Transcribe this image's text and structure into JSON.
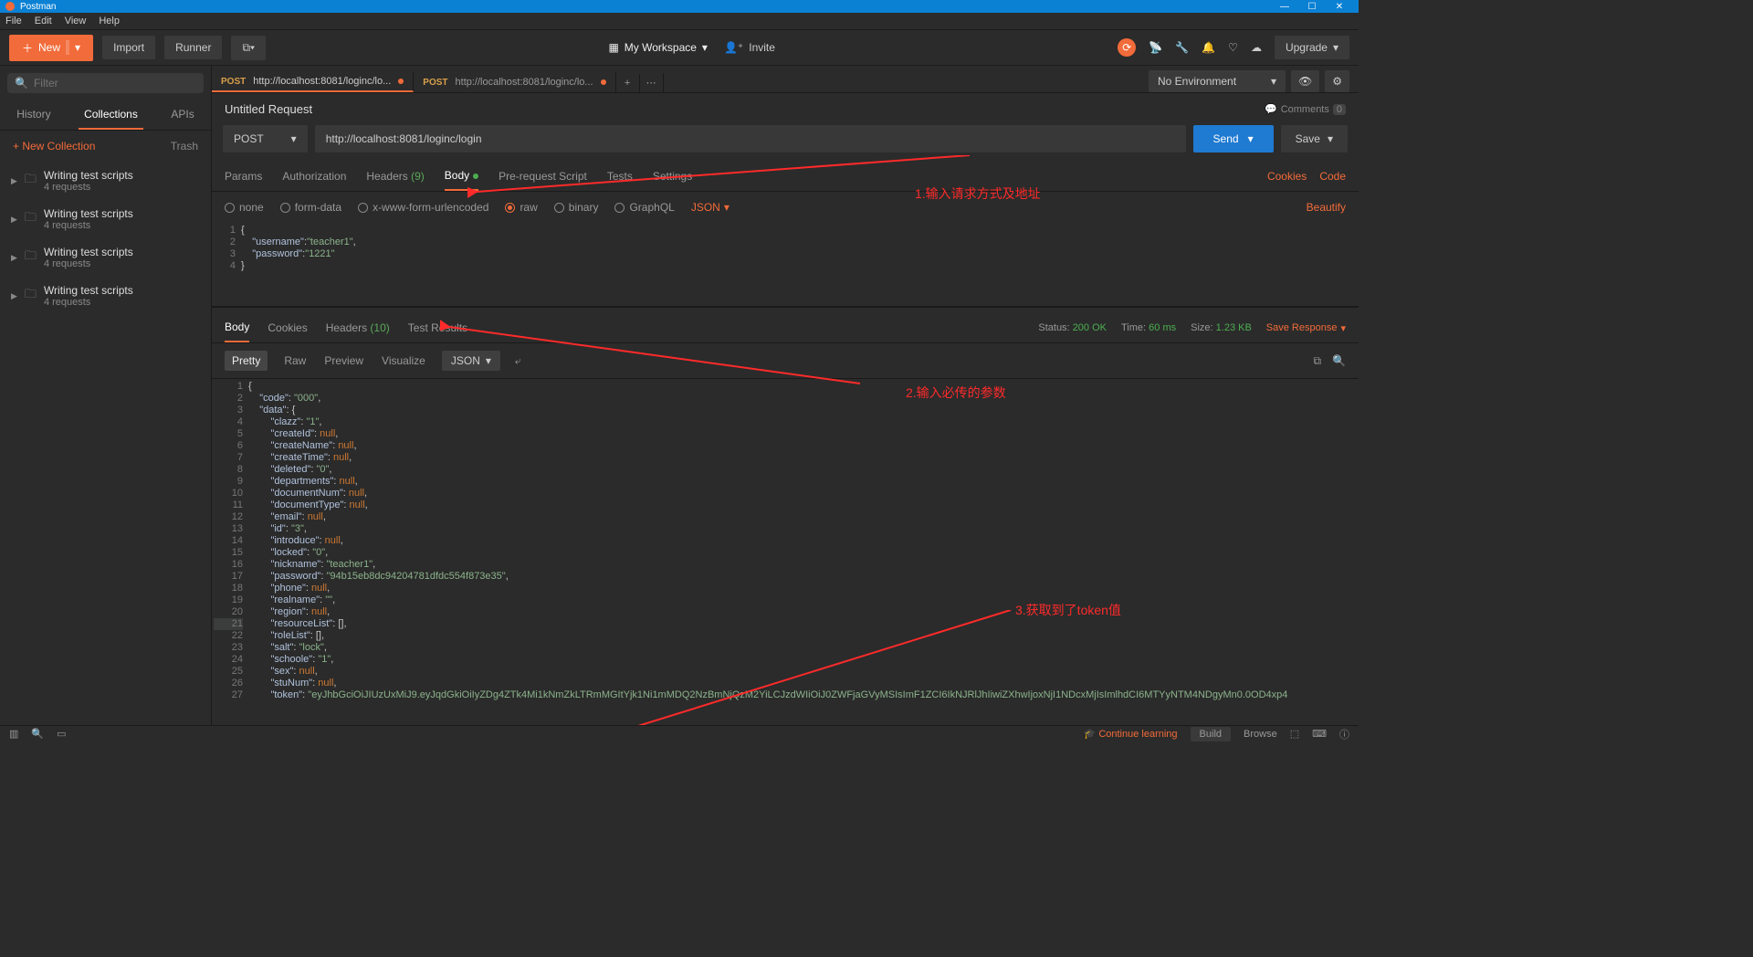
{
  "titlebar": {
    "app": "Postman"
  },
  "menubar": [
    "File",
    "Edit",
    "View",
    "Help"
  ],
  "toolbar": {
    "new": "New",
    "import": "Import",
    "runner": "Runner",
    "workspace": "My Workspace",
    "invite": "Invite",
    "upgrade": "Upgrade"
  },
  "sidebar": {
    "filter_placeholder": "Filter",
    "tabs": [
      "History",
      "Collections",
      "APIs"
    ],
    "active_tab": "Collections",
    "new_collection": "New Collection",
    "trash": "Trash",
    "collections": [
      {
        "name": "Writing test scripts",
        "sub": "4 requests"
      },
      {
        "name": "Writing test scripts",
        "sub": "4 requests"
      },
      {
        "name": "Writing test scripts",
        "sub": "4 requests"
      },
      {
        "name": "Writing test scripts",
        "sub": "4 requests"
      }
    ]
  },
  "tabs": [
    {
      "method": "POST",
      "label": "http://localhost:8081/loginc/lo...",
      "active": true,
      "dirty": true
    },
    {
      "method": "POST",
      "label": "http://localhost:8081/loginc/lo...",
      "active": false,
      "dirty": true
    }
  ],
  "env": {
    "label": "No Environment"
  },
  "request": {
    "name": "Untitled Request",
    "method": "POST",
    "url": "http://localhost:8081/loginc/login",
    "send": "Send",
    "save": "Save",
    "comments": "Comments",
    "comments_count": "0"
  },
  "reqtabs": {
    "params": "Params",
    "auth": "Authorization",
    "headers": "Headers",
    "headers_count": "(9)",
    "body": "Body",
    "prereq": "Pre-request Script",
    "tests": "Tests",
    "settings": "Settings",
    "cookies": "Cookies",
    "code": "Code"
  },
  "bodyopts": {
    "none": "none",
    "formdata": "form-data",
    "xwww": "x-www-form-urlencoded",
    "raw": "raw",
    "binary": "binary",
    "graphql": "GraphQL",
    "json": "JSON",
    "beautify": "Beautify"
  },
  "req_body_lines": [
    {
      "n": "1",
      "html": "<span class='p'>{</span>"
    },
    {
      "n": "2",
      "html": "    <span class='k'>\"username\"</span><span class='p'>:</span><span class='s'>\"teacher1\"</span><span class='p'>,</span>"
    },
    {
      "n": "3",
      "html": "    <span class='k'>\"password\"</span><span class='p'>:</span><span class='s'>\"1221\"</span>"
    },
    {
      "n": "4",
      "html": "<span class='p'>}</span>"
    }
  ],
  "resptabs": {
    "body": "Body",
    "cookies": "Cookies",
    "headers": "Headers",
    "headers_count": "(10)",
    "tests": "Test Results",
    "status_label": "Status:",
    "status_val": "200 OK",
    "time_label": "Time:",
    "time_val": "60 ms",
    "size_label": "Size:",
    "size_val": "1.23 KB",
    "save": "Save Response"
  },
  "viewopts": {
    "pretty": "Pretty",
    "raw": "Raw",
    "preview": "Preview",
    "visualize": "Visualize",
    "fmt": "JSON"
  },
  "resp_lines": [
    {
      "n": "1",
      "html": "<span class='p'>{</span>"
    },
    {
      "n": "2",
      "html": "    <span class='k'>\"code\"</span>: <span class='s'>\"000\"</span>,"
    },
    {
      "n": "3",
      "html": "    <span class='k'>\"data\"</span>: <span class='p'>{</span>"
    },
    {
      "n": "4",
      "html": "        <span class='k'>\"clazz\"</span>: <span class='s'>\"1\"</span>,"
    },
    {
      "n": "5",
      "html": "        <span class='k'>\"createId\"</span>: <span class='n'>null</span>,"
    },
    {
      "n": "6",
      "html": "        <span class='k'>\"createName\"</span>: <span class='n'>null</span>,"
    },
    {
      "n": "7",
      "html": "        <span class='k'>\"createTime\"</span>: <span class='n'>null</span>,"
    },
    {
      "n": "8",
      "html": "        <span class='k'>\"deleted\"</span>: <span class='s'>\"0\"</span>,"
    },
    {
      "n": "9",
      "html": "        <span class='k'>\"departments\"</span>: <span class='n'>null</span>,"
    },
    {
      "n": "10",
      "html": "        <span class='k'>\"documentNum\"</span>: <span class='n'>null</span>,"
    },
    {
      "n": "11",
      "html": "        <span class='k'>\"documentType\"</span>: <span class='n'>null</span>,"
    },
    {
      "n": "12",
      "html": "        <span class='k'>\"email\"</span>: <span class='n'>null</span>,"
    },
    {
      "n": "13",
      "html": "        <span class='k'>\"id\"</span>: <span class='s'>\"3\"</span>,"
    },
    {
      "n": "14",
      "html": "        <span class='k'>\"introduce\"</span>: <span class='n'>null</span>,"
    },
    {
      "n": "15",
      "html": "        <span class='k'>\"locked\"</span>: <span class='s'>\"0\"</span>,"
    },
    {
      "n": "16",
      "html": "        <span class='k'>\"nickname\"</span>: <span class='s'>\"teacher1\"</span>,"
    },
    {
      "n": "17",
      "html": "        <span class='k'>\"password\"</span>: <span class='s'>\"94b15eb8dc94204781dfdc554f873e35\"</span>,"
    },
    {
      "n": "18",
      "html": "        <span class='k'>\"phone\"</span>: <span class='n'>null</span>,"
    },
    {
      "n": "19",
      "html": "        <span class='k'>\"realname\"</span>: <span class='s'>\"\"</span>,"
    },
    {
      "n": "20",
      "html": "        <span class='k'>\"region\"</span>: <span class='n'>null</span>,"
    },
    {
      "n": "21",
      "html": "        <span class='k'>\"resourceList\"</span>: <span class='p'>[]</span>,"
    },
    {
      "n": "22",
      "html": "        <span class='k'>\"roleList\"</span>: <span class='p'>[]</span>,"
    },
    {
      "n": "23",
      "html": "        <span class='k'>\"salt\"</span>: <span class='s'>\"lock\"</span>,"
    },
    {
      "n": "24",
      "html": "        <span class='k'>\"schoole\"</span>: <span class='s'>\"1\"</span>,"
    },
    {
      "n": "25",
      "html": "        <span class='k'>\"sex\"</span>: <span class='n'>null</span>,"
    },
    {
      "n": "26",
      "html": "        <span class='k'>\"stuNum\"</span>: <span class='n'>null</span>,"
    },
    {
      "n": "27",
      "html": "        <span class='k'>\"token\"</span>: <span class='s'>\"eyJhbGciOiJIUzUxMiJ9.eyJqdGkiOiIyZDg4ZTk4Mi1kNmZkLTRmMGItYjk1Ni1mMDQ2NzBmNjQzM2YiLCJzdWIiOiJ0ZWFjaGVyMSIsImF1ZCI6IkNJRlJhIiwiZXhwIjoxNjI1NDcxMjIsImlhdCI6MTYyNTM4NDgyMn0.0OD4xp4</span>"
    }
  ],
  "annotations": {
    "a1": "1.输入请求方式及地址",
    "a2": "2.输入必传的参数",
    "a3": "3.获取到了token值"
  },
  "statusbar": {
    "continue": "Continue learning",
    "build": "Build",
    "browse": "Browse"
  }
}
